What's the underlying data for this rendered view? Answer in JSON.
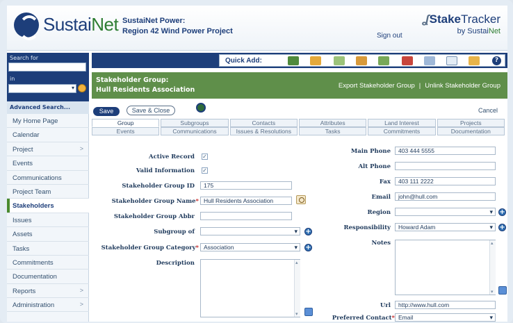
{
  "header": {
    "brand_main": "Sustai",
    "brand_accent": "Net",
    "project_line1": "SustaiNet Power:",
    "project_line2": "Region 42 Wind Power Project",
    "sign_out": "Sign out",
    "product_bold": "Stake",
    "product_regular": "Tracker",
    "by_prefix": "by Sustai",
    "by_accent": "Net"
  },
  "sidebar": {
    "search_for_label": "Search for",
    "in_label": "in",
    "advanced_search": "Advanced Search...",
    "nav": [
      {
        "label": "My Home Page",
        "caret": ""
      },
      {
        "label": "Calendar",
        "caret": ""
      },
      {
        "label": "Project",
        "caret": ">"
      },
      {
        "label": "Events",
        "caret": ""
      },
      {
        "label": "Communications",
        "caret": ""
      },
      {
        "label": "Project Team",
        "caret": ""
      },
      {
        "label": "Stakeholders",
        "caret": "",
        "active": true
      },
      {
        "label": "Issues",
        "caret": ""
      },
      {
        "label": "Assets",
        "caret": ""
      },
      {
        "label": "Tasks",
        "caret": ""
      },
      {
        "label": "Commitments",
        "caret": ""
      },
      {
        "label": "Documentation",
        "caret": ""
      },
      {
        "label": "Reports",
        "caret": ">"
      },
      {
        "label": "Administration",
        "caret": ">"
      }
    ]
  },
  "quick_add": {
    "label": "Quick Add:",
    "icons": [
      "add-vehicle-icon",
      "add-truck-icon",
      "add-document-icon",
      "add-group-icon",
      "add-checklist-icon",
      "add-commitment-icon",
      "add-email-icon",
      "add-page-icon",
      "add-folder-icon",
      "help-icon"
    ],
    "help_glyph": "?"
  },
  "record": {
    "type_label": "Stakeholder Group:",
    "name": "Hull Residents Association",
    "export_link": "Export Stakeholder Group",
    "link_separator": "|",
    "unlink_link": "Unlink Stakeholder Group"
  },
  "actions": {
    "save": "Save",
    "save_close": "Save & Close",
    "cancel": "Cancel"
  },
  "tabs": {
    "row1": [
      "Group",
      "Subgroups",
      "Contacts",
      "Attributes",
      "Land Interest",
      "Projects"
    ],
    "row2": [
      "Events",
      "Communications",
      "Issues & Resolutions",
      "Tasks",
      "Commitments",
      "Documentation"
    ],
    "active": "Group"
  },
  "form": {
    "active_record": {
      "label": "Active Record",
      "checked": true
    },
    "valid_information": {
      "label": "Valid Information",
      "checked": true
    },
    "group_id": {
      "label": "Stakeholder Group ID",
      "value": "175"
    },
    "group_name": {
      "label": "Stakeholder Group Name",
      "required": "*",
      "value": "Hull Residents Association"
    },
    "group_abbr": {
      "label": "Stakeholder Group Abbr",
      "value": ""
    },
    "subgroup_of": {
      "label": "Subgroup of",
      "value": ""
    },
    "group_category": {
      "label": "Stakeholder Group Category",
      "required": "*",
      "value": "Association"
    },
    "description": {
      "label": "Description",
      "value": ""
    },
    "main_phone": {
      "label": "Main Phone",
      "value": "403 444 5555"
    },
    "alt_phone": {
      "label": "Alt Phone",
      "value": ""
    },
    "fax": {
      "label": "Fax",
      "value": "403 111 2222"
    },
    "email": {
      "label": "Email",
      "value": "john@hull.com"
    },
    "region": {
      "label": "Region",
      "value": ""
    },
    "responsibility": {
      "label": "Responsibility",
      "value": "Howard Adam"
    },
    "notes": {
      "label": "Notes",
      "value": ""
    },
    "url": {
      "label": "Url",
      "value": "http://www.hull.com"
    },
    "preferred_contact": {
      "label": "Preferred Contact",
      "required": "*",
      "value": "Email"
    }
  },
  "colors": {
    "navy": "#1d3e7a",
    "green_panel": "#5f8f4a",
    "brand_green": "#2e7d32",
    "required_red": "#c62828"
  }
}
